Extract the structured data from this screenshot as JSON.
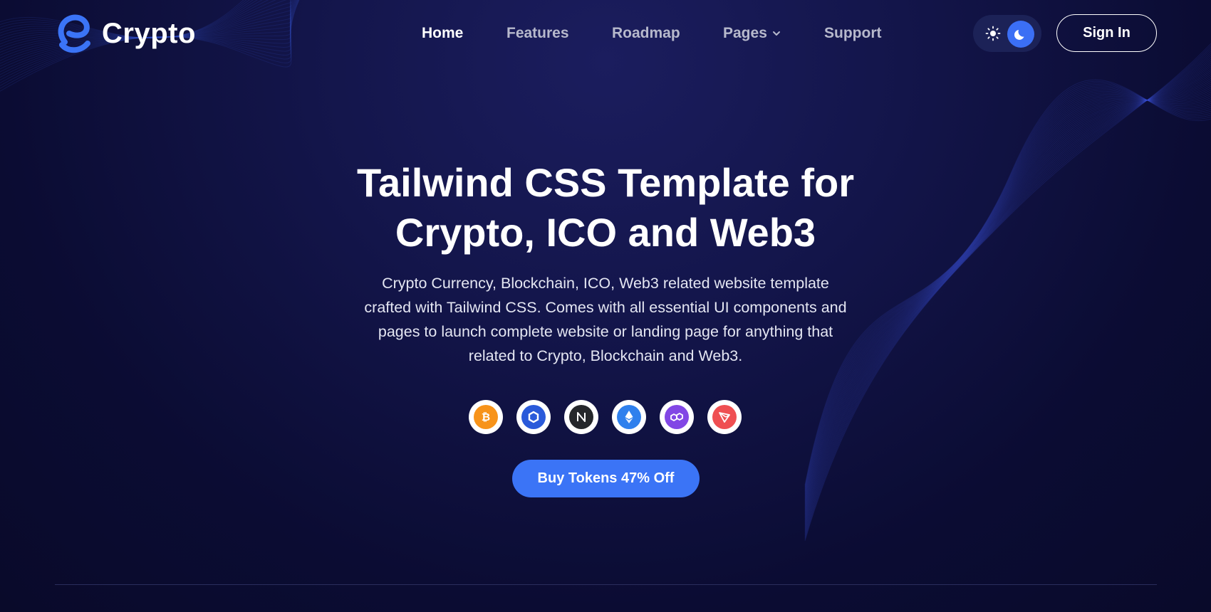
{
  "brand": {
    "name": "Crypto",
    "accent": "#3b74f6"
  },
  "nav": {
    "items": [
      {
        "label": "Home",
        "active": true
      },
      {
        "label": "Features",
        "active": false
      },
      {
        "label": "Roadmap",
        "active": false
      },
      {
        "label": "Pages",
        "active": false,
        "has_dropdown": true
      },
      {
        "label": "Support",
        "active": false
      }
    ]
  },
  "theme_toggle": {
    "light_icon": "sun-icon",
    "dark_icon": "moon-icon",
    "selected": "dark"
  },
  "header": {
    "signin_label": "Sign In"
  },
  "hero": {
    "title_line1": "Tailwind CSS Template for",
    "title_line2": "Crypto, ICO and Web3",
    "subtitle_lines": [
      "Crypto Currency, Blockchain, ICO, Web3 related website template",
      "crafted with Tailwind CSS. Comes with all essential UI components and",
      "pages to launch complete website or landing page for anything that",
      "related to Crypto, Blockchain and Web3."
    ],
    "coins": [
      {
        "icon": "bitcoin-icon",
        "color": "#f7931a"
      },
      {
        "icon": "chainlink-icon",
        "color": "#2a5ada"
      },
      {
        "icon": "near-icon",
        "color": "#25272b"
      },
      {
        "icon": "ethereum-icon",
        "color": "#2f80ed"
      },
      {
        "icon": "polygon-icon",
        "color": "#8247e5"
      },
      {
        "icon": "tron-icon",
        "color": "#ef4f52"
      }
    ],
    "cta_label": "Buy Tokens 47% Off"
  },
  "colors": {
    "background": "#0b0c33",
    "toggle_active": "#3b6ff5",
    "divider": "#2a2d5c"
  }
}
